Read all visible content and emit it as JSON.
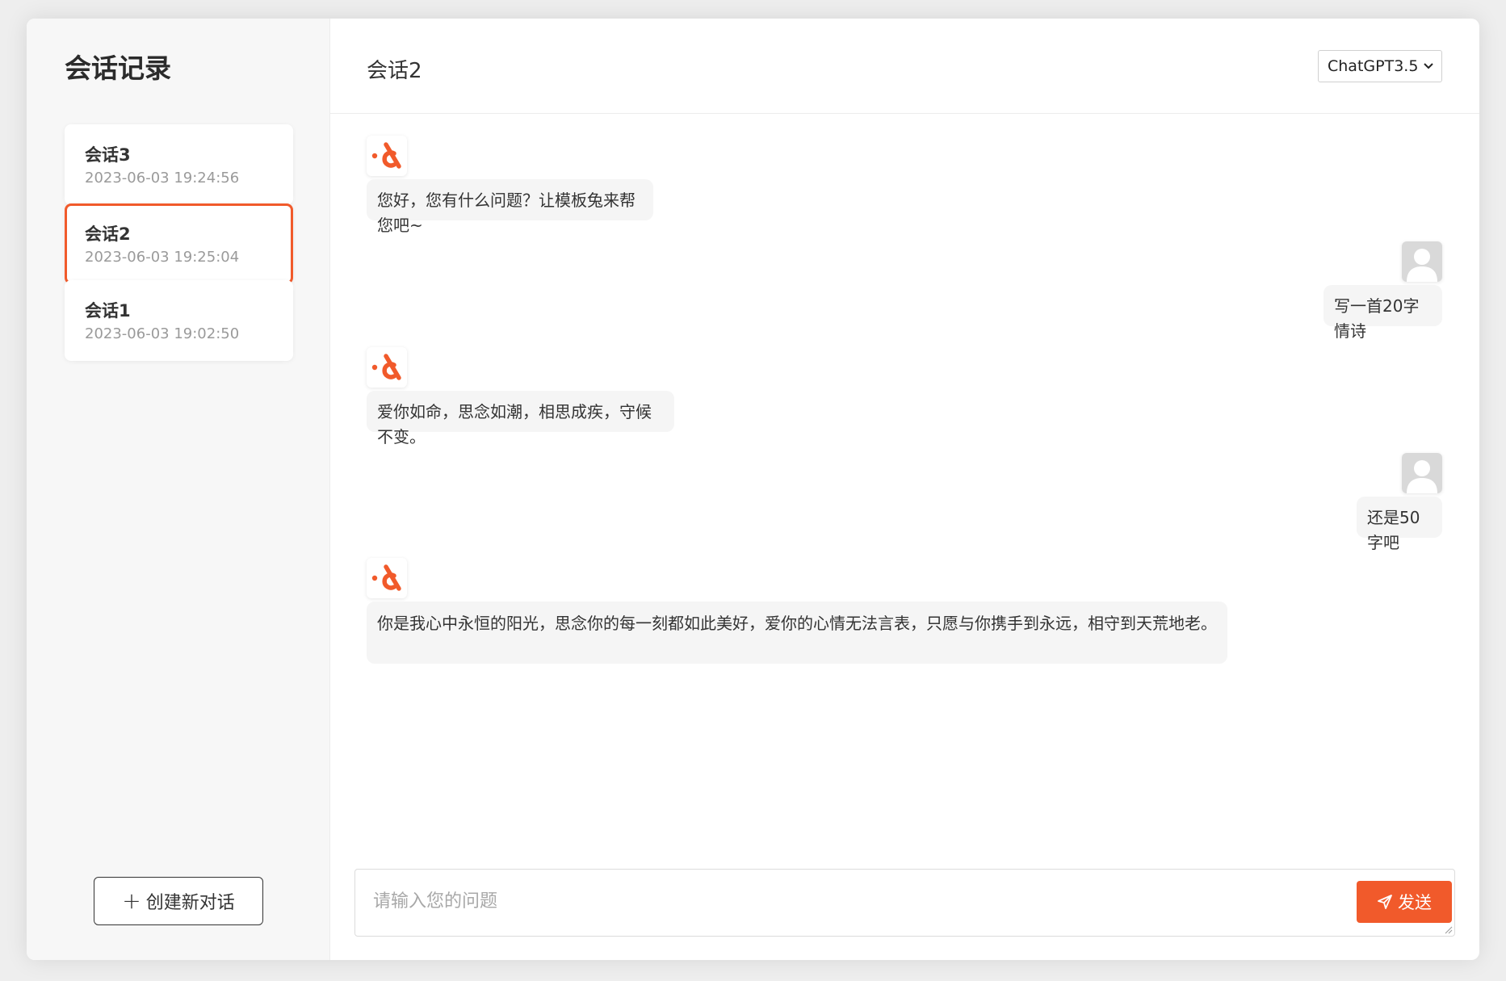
{
  "sidebar": {
    "title": "会话记录",
    "conversations": [
      {
        "name": "会话3",
        "time": "2023-06-03 19:24:56",
        "active": false
      },
      {
        "name": "会话2",
        "time": "2023-06-03 19:25:04",
        "active": true
      },
      {
        "name": "会话1",
        "time": "2023-06-03 19:02:50",
        "active": false
      }
    ],
    "new_chat_label": "创建新对话"
  },
  "header": {
    "title": "会话2",
    "model_selected": "ChatGPT3.5"
  },
  "messages": [
    {
      "role": "assistant",
      "text": "您好，您有什么问题？让模板兔来帮您吧~"
    },
    {
      "role": "user",
      "text": "写一首20字情诗"
    },
    {
      "role": "assistant",
      "text": "爱你如命，思念如潮，相思成疾，守候不变。"
    },
    {
      "role": "user",
      "text": "还是50字吧"
    },
    {
      "role": "assistant",
      "text": "你是我心中永恒的阳光，思念你的每一刻都如此美好，爱你的心情无法言表，只愿与你携手到永远，相守到天荒地老。"
    }
  ],
  "input": {
    "placeholder": "请输入您的问题",
    "value": "",
    "send_label": "发送"
  },
  "colors": {
    "accent": "#f15a2b",
    "sidebar_bg": "#f7f7f7",
    "bubble_bg": "#f5f5f5"
  },
  "icons": {
    "assistant_avatar": "bot-logo-icon",
    "user_avatar": "user-avatar-icon",
    "send": "paper-plane-icon",
    "new_chat": "plus-icon",
    "model_dropdown": "chevron-down-icon"
  }
}
